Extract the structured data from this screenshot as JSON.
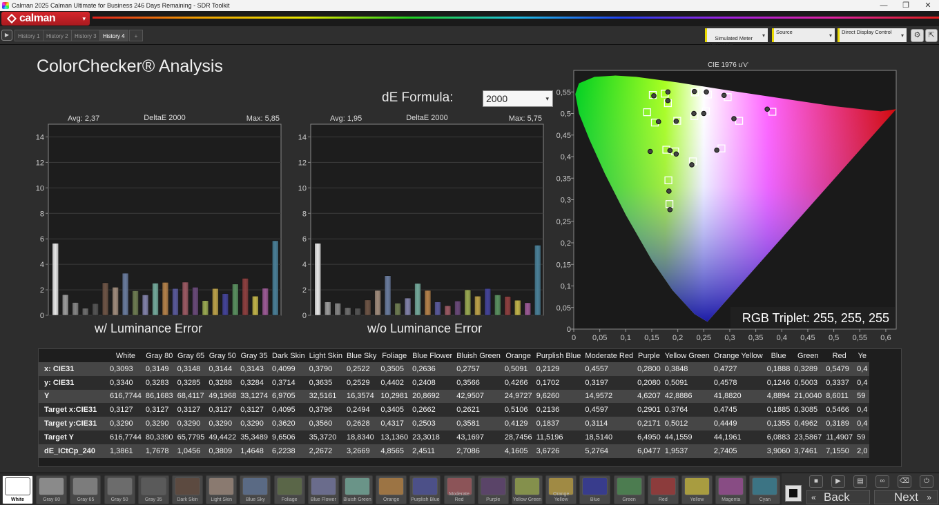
{
  "window": {
    "title": "Calman 2025 Calman Ultimate for Business 246 Days Remaining  - SDR Toolkit",
    "buttons": [
      "—",
      "❐",
      "✕"
    ]
  },
  "logo": {
    "text": "calman",
    "menu_glyph": "▾"
  },
  "tabs": {
    "play_glyph": "▶",
    "items": [
      "History 1",
      "History 2",
      "History 3",
      "History 4"
    ],
    "add_glyph": "+"
  },
  "top_controls": {
    "meter": "Simulated Meter\nTest Mode",
    "source": "Source",
    "display": "Direct Display Control",
    "arrow": "▾",
    "settings_glyph": "⚙",
    "expand_glyph": "⇱"
  },
  "page": {
    "title": "ColorChecker® Analysis",
    "formula_label": "dE Formula:",
    "formula_value": "2000",
    "formula_arrow": "▾"
  },
  "colors": {
    "accent": "#e8d800",
    "brand": "#c8202a"
  },
  "chart_data": [
    {
      "type": "bar",
      "title": "DeltaE 2000",
      "avg_label": "Avg: 2,37",
      "max_label": "Max: 5,85",
      "caption": "w/ Luminance Error",
      "ylim": [
        0,
        15
      ],
      "yticks": [
        0,
        2,
        4,
        6,
        8,
        10,
        12,
        14
      ],
      "categories": [
        "White",
        "Gray 80",
        "Gray 65",
        "Gray 50",
        "Gray 35",
        "Dark Skin",
        "Light Skin",
        "Blue Sky",
        "Foliage",
        "Blue Flower",
        "Bluish Green",
        "Orange",
        "Purplish Blue",
        "Moderate Red",
        "Purple",
        "Yellow Green",
        "Orange Yellow",
        "Blue",
        "Green",
        "Red",
        "Yellow",
        "Magenta",
        "Cyan"
      ],
      "values": [
        5.65,
        1.62,
        1.0,
        0.55,
        0.92,
        2.55,
        2.2,
        3.3,
        1.92,
        1.6,
        2.52,
        2.58,
        2.1,
        2.6,
        2.2,
        1.15,
        2.1,
        1.7,
        2.45,
        2.9,
        1.5,
        2.12,
        5.85
      ],
      "colors": [
        "#e8e8e8",
        "#9c9c9c",
        "#858585",
        "#6e6e6e",
        "#555555",
        "#6e5546",
        "#a08c7c",
        "#6a7c9e",
        "#6e7c52",
        "#8282aa",
        "#74aa9c",
        "#b4824a",
        "#5a5a9c",
        "#9c5a64",
        "#6a4a7a",
        "#9aaa52",
        "#bca24a",
        "#44449a",
        "#5a9060",
        "#8e4040",
        "#c2b44a",
        "#9c5a96",
        "#4a8098"
      ]
    },
    {
      "type": "bar",
      "title": "DeltaE 2000",
      "avg_label": "Avg: 1,95",
      "max_label": "Max: 5,75",
      "caption": "w/o Luminance Error",
      "ylim": [
        0,
        15
      ],
      "yticks": [
        0,
        2,
        4,
        6,
        8,
        10,
        12,
        14
      ],
      "categories": [
        "White",
        "Gray 80",
        "Gray 65",
        "Gray 50",
        "Gray 35",
        "Dark Skin",
        "Light Skin",
        "Blue Sky",
        "Foliage",
        "Blue Flower",
        "Bluish Green",
        "Orange",
        "Purplish Blue",
        "Moderate Red",
        "Purple",
        "Yellow Green",
        "Orange Yellow",
        "Blue",
        "Green",
        "Red",
        "Yellow",
        "Magenta",
        "Cyan"
      ],
      "values": [
        5.65,
        1.05,
        0.95,
        0.6,
        0.55,
        1.2,
        1.95,
        3.1,
        0.95,
        1.35,
        2.5,
        1.95,
        1.05,
        0.75,
        1.12,
        2.0,
        1.5,
        2.1,
        1.6,
        1.48,
        1.18,
        0.98,
        5.5
      ],
      "colors": [
        "#e8e8e8",
        "#9c9c9c",
        "#858585",
        "#6e6e6e",
        "#555555",
        "#6e5546",
        "#a08c7c",
        "#6a7c9e",
        "#6e7c52",
        "#8282aa",
        "#74aa9c",
        "#b4824a",
        "#5a5a9c",
        "#9c5a64",
        "#6a4a7a",
        "#9aaa52",
        "#bca24a",
        "#44449a",
        "#5a9060",
        "#8e4040",
        "#c2b44a",
        "#9c5a96",
        "#4a8098"
      ]
    },
    {
      "type": "scatter",
      "title": "CIE 1976 u'v'",
      "triplet_label": "RGB Triplet: 255, 255, 255",
      "xlim": [
        0,
        0.62
      ],
      "ylim": [
        0,
        0.6
      ],
      "xticks": [
        "0",
        "0,05",
        "0,1",
        "0,15",
        "0,2",
        "0,25",
        "0,3",
        "0,35",
        "0,4",
        "0,45",
        "0,5",
        "0,55",
        "0,6"
      ],
      "yticks": [
        "0",
        "0,05",
        "0,1",
        "0,15",
        "0,2",
        "0,25",
        "0,3",
        "0,35",
        "0,4",
        "0,45",
        "0,5",
        "0,55"
      ],
      "targets": [
        [
          0.199,
          0.483
        ],
        [
          0.181,
          0.524
        ],
        [
          0.156,
          0.479
        ],
        [
          0.178,
          0.416
        ],
        [
          0.232,
          0.494
        ],
        [
          0.258,
          0.544
        ],
        [
          0.141,
          0.503
        ],
        [
          0.152,
          0.543
        ],
        [
          0.175,
          0.546
        ],
        [
          0.195,
          0.412
        ],
        [
          0.229,
          0.389
        ],
        [
          0.233,
          0.549
        ],
        [
          0.254,
          0.505
        ],
        [
          0.182,
          0.345
        ],
        [
          0.184,
          0.29
        ],
        [
          0.284,
          0.419
        ],
        [
          0.318,
          0.483
        ],
        [
          0.382,
          0.504
        ],
        [
          0.296,
          0.538
        ]
      ],
      "measured": [
        [
          0.197,
          0.482
        ],
        [
          0.181,
          0.53
        ],
        [
          0.163,
          0.481
        ],
        [
          0.185,
          0.414
        ],
        [
          0.231,
          0.5
        ],
        [
          0.25,
          0.5
        ],
        [
          0.147,
          0.412
        ],
        [
          0.154,
          0.541
        ],
        [
          0.181,
          0.55
        ],
        [
          0.197,
          0.406
        ],
        [
          0.227,
          0.381
        ],
        [
          0.232,
          0.551
        ],
        [
          0.255,
          0.55
        ],
        [
          0.183,
          0.32
        ],
        [
          0.185,
          0.277
        ],
        [
          0.275,
          0.415
        ],
        [
          0.308,
          0.488
        ],
        [
          0.372,
          0.51
        ],
        [
          0.289,
          0.542
        ]
      ]
    }
  ],
  "table": {
    "columns": [
      "",
      "White",
      "Gray 80",
      "Gray 65",
      "Gray 50",
      "Gray 35",
      "Dark Skin",
      "Light Skin",
      "Blue Sky",
      "Foliage",
      "Blue Flower",
      "Bluish Green",
      "Orange",
      "Purplish Blue",
      "Moderate Red",
      "Purple",
      "Yellow Green",
      "Orange Yellow",
      "Blue",
      "Green",
      "Red",
      "Ye"
    ],
    "rows": [
      [
        "x: CIE31",
        "0,3093",
        "0,3149",
        "0,3148",
        "0,3144",
        "0,3143",
        "0,4099",
        "0,3790",
        "0,2522",
        "0,3505",
        "0,2636",
        "0,2757",
        "0,5091",
        "0,2129",
        "0,4557",
        "0,2800",
        "0,3848",
        "0,4727",
        "0,1888",
        "0,3289",
        "0,5479",
        "0,4"
      ],
      [
        "y: CIE31",
        "0,3340",
        "0,3283",
        "0,3285",
        "0,3288",
        "0,3284",
        "0,3714",
        "0,3635",
        "0,2529",
        "0,4402",
        "0,2408",
        "0,3566",
        "0,4266",
        "0,1702",
        "0,3197",
        "0,2080",
        "0,5091",
        "0,4578",
        "0,1246",
        "0,5003",
        "0,3337",
        "0,4"
      ],
      [
        "Y",
        "616,7744",
        "86,1683",
        "68,4117",
        "49,1968",
        "33,1274",
        "6,9705",
        "32,5161",
        "16,3574",
        "10,2981",
        "20,8692",
        "42,9507",
        "24,9727",
        "9,6260",
        "14,9572",
        "4,6207",
        "42,8886",
        "41,8820",
        "4,8894",
        "21,0040",
        "8,6011",
        "59"
      ],
      [
        "Target x:CIE31",
        "0,3127",
        "0,3127",
        "0,3127",
        "0,3127",
        "0,3127",
        "0,4095",
        "0,3796",
        "0,2494",
        "0,3405",
        "0,2662",
        "0,2621",
        "0,5106",
        "0,2136",
        "0,4597",
        "0,2901",
        "0,3764",
        "0,4745",
        "0,1885",
        "0,3085",
        "0,5466",
        "0,4"
      ],
      [
        "Target y:CIE31",
        "0,3290",
        "0,3290",
        "0,3290",
        "0,3290",
        "0,3290",
        "0,3620",
        "0,3560",
        "0,2628",
        "0,4317",
        "0,2503",
        "0,3581",
        "0,4129",
        "0,1837",
        "0,3114",
        "0,2171",
        "0,5012",
        "0,4449",
        "0,1355",
        "0,4962",
        "0,3189",
        "0,4"
      ],
      [
        "Target Y",
        "616,7744",
        "80,3390",
        "65,7795",
        "49,4422",
        "35,3489",
        "9,6506",
        "35,3720",
        "18,8340",
        "13,1360",
        "23,3018",
        "43,1697",
        "28,7456",
        "11,5196",
        "18,5140",
        "6,4950",
        "44,1559",
        "44,1961",
        "6,0883",
        "23,5867",
        "11,4907",
        "59"
      ],
      [
        "dE_ICtCp_240",
        "1,3861",
        "1,7678",
        "1,0456",
        "0,3809",
        "1,4648",
        "6,2238",
        "2,2672",
        "3,2669",
        "4,8565",
        "2,4511",
        "2,7086",
        "4,1605",
        "3,6726",
        "5,2764",
        "6,0477",
        "1,9537",
        "2,7405",
        "3,9060",
        "3,7461",
        "7,1550",
        "2,0"
      ]
    ]
  },
  "swatches": [
    {
      "label": "White",
      "color": "#ffffff"
    },
    {
      "label": "Gray 80",
      "color": "#8a8a8a"
    },
    {
      "label": "Gray 65",
      "color": "#7c7c7c"
    },
    {
      "label": "Gray 50",
      "color": "#6c6c6c"
    },
    {
      "label": "Gray 35",
      "color": "#5a5a5a"
    },
    {
      "label": "Dark Skin",
      "color": "#5c4a40"
    },
    {
      "label": "Light Skin",
      "color": "#8a7a70"
    },
    {
      "label": "Blue Sky",
      "color": "#5a6a84"
    },
    {
      "label": "Foliage",
      "color": "#5a6648"
    },
    {
      "label": "Blue Flower",
      "color": "#6a6c8c"
    },
    {
      "label": "Bluish Green",
      "color": "#6a9488"
    },
    {
      "label": "Orange",
      "color": "#9c7444"
    },
    {
      "label": "Purplish Blue",
      "color": "#4c5088"
    },
    {
      "label": "Moderate Red",
      "color": "#8c5458"
    },
    {
      "label": "Purple",
      "color": "#5a4468"
    },
    {
      "label": "Yellow Green",
      "color": "#84904c"
    },
    {
      "label": "Orange Yellow",
      "color": "#a08a44"
    },
    {
      "label": "Blue",
      "color": "#383c8c"
    },
    {
      "label": "Green",
      "color": "#4c7c50"
    },
    {
      "label": "Red",
      "color": "#8c3c3c"
    },
    {
      "label": "Yellow",
      "color": "#a89c40"
    },
    {
      "label": "Magenta",
      "color": "#884c84"
    },
    {
      "label": "Cyan",
      "color": "#3c7484"
    }
  ],
  "nav": {
    "back": "Back",
    "next": "Next",
    "back_glyph": "«",
    "next_glyph": "»"
  }
}
